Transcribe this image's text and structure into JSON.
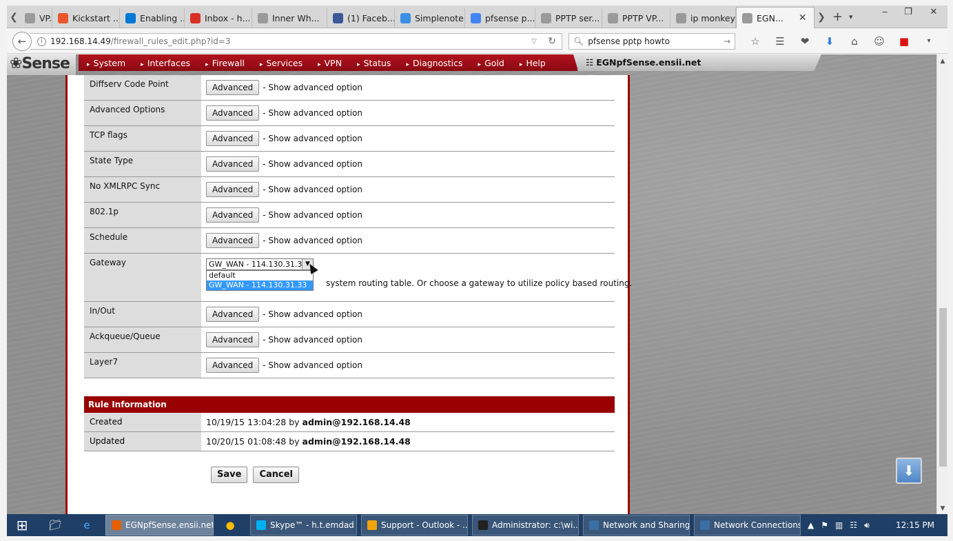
{
  "browser": {
    "tabs": [
      {
        "label": "VP...",
        "icon": "tab-icon"
      },
      {
        "label": "Kickstart ...",
        "icon": "kickstarter-icon",
        "color": "#e8572c"
      },
      {
        "label": "Enabling ...",
        "icon": "microsoft-icon",
        "color": "#0078d7"
      },
      {
        "label": "Inbox - h...",
        "icon": "gmail-icon",
        "color": "#d93025"
      },
      {
        "label": "Inner Wh...",
        "icon": "page-icon"
      },
      {
        "label": "(1) Faceb...",
        "icon": "facebook-icon",
        "color": "#3b5998"
      },
      {
        "label": "Simplenote",
        "icon": "simplenote-icon",
        "color": "#3a8fe3"
      },
      {
        "label": "pfsense p...",
        "icon": "google-icon",
        "color": "#4285f4"
      },
      {
        "label": "PPTP ser...",
        "icon": "pptp-icon"
      },
      {
        "label": "PPTP VP...",
        "icon": "pfsense-icon"
      },
      {
        "label": "ip monkey",
        "icon": "page-icon"
      },
      {
        "label": "EGN...",
        "icon": "pfsense-icon"
      }
    ],
    "url_host": "192.168.14.49",
    "url_path": "/firewall_rules_edit.php?id=3",
    "search_value": "pfsense pptp howto"
  },
  "pfsense": {
    "logo": "Sense",
    "menu": [
      "System",
      "Interfaces",
      "Firewall",
      "Services",
      "VPN",
      "Status",
      "Diagnostics",
      "Gold",
      "Help"
    ],
    "hostname": "EGNpfSense.ensii.net"
  },
  "form": {
    "advanced_label": "Advanced",
    "advanced_desc": "- Show advanced option",
    "rows": [
      {
        "label": "Diffserv Code Point"
      },
      {
        "label": "Advanced Options"
      },
      {
        "label": "TCP flags"
      },
      {
        "label": "State Type"
      },
      {
        "label": "No XMLRPC Sync"
      },
      {
        "label": "802.1p"
      },
      {
        "label": "Schedule"
      }
    ],
    "gateway": {
      "label": "Gateway",
      "selected": "GW_WAN - 114.130.31.33",
      "options": [
        "default",
        "GW_WAN - 114.130.31.33"
      ],
      "help": "system routing table. Or choose a gateway to utilize policy based routing."
    },
    "rows_after": [
      {
        "label": "In/Out"
      },
      {
        "label": "Ackqueue/Queue"
      },
      {
        "label": "Layer7"
      }
    ]
  },
  "rule_info": {
    "title": "Rule Information",
    "created_label": "Created",
    "created_time": "10/19/15 13:04:28 by",
    "created_by": "admin@192.168.14.48",
    "updated_label": "Updated",
    "updated_time": "10/20/15 01:08:48 by",
    "updated_by": "admin@192.168.14.48"
  },
  "actions": {
    "save": "Save",
    "cancel": "Cancel"
  },
  "taskbar": {
    "items": [
      {
        "label": "EGNpfSense.ensii.net...",
        "icon": "firefox-icon",
        "color": "#e66000"
      },
      {
        "label": "Skype™ - h.t.emdad",
        "icon": "skype-icon",
        "color": "#00aff0"
      },
      {
        "label": "Support - Outlook - ...",
        "icon": "outlook-icon",
        "color": "#f0a30a"
      },
      {
        "label": "Administrator: c:\\wi...",
        "icon": "cmd-icon",
        "color": "#222222"
      },
      {
        "label": "Network and Sharing...",
        "icon": "network-icon",
        "color": "#3a6ea5"
      },
      {
        "label": "Network Connections",
        "icon": "network-connections-icon",
        "color": "#3a6ea5"
      }
    ],
    "clock": "12:15 PM"
  }
}
